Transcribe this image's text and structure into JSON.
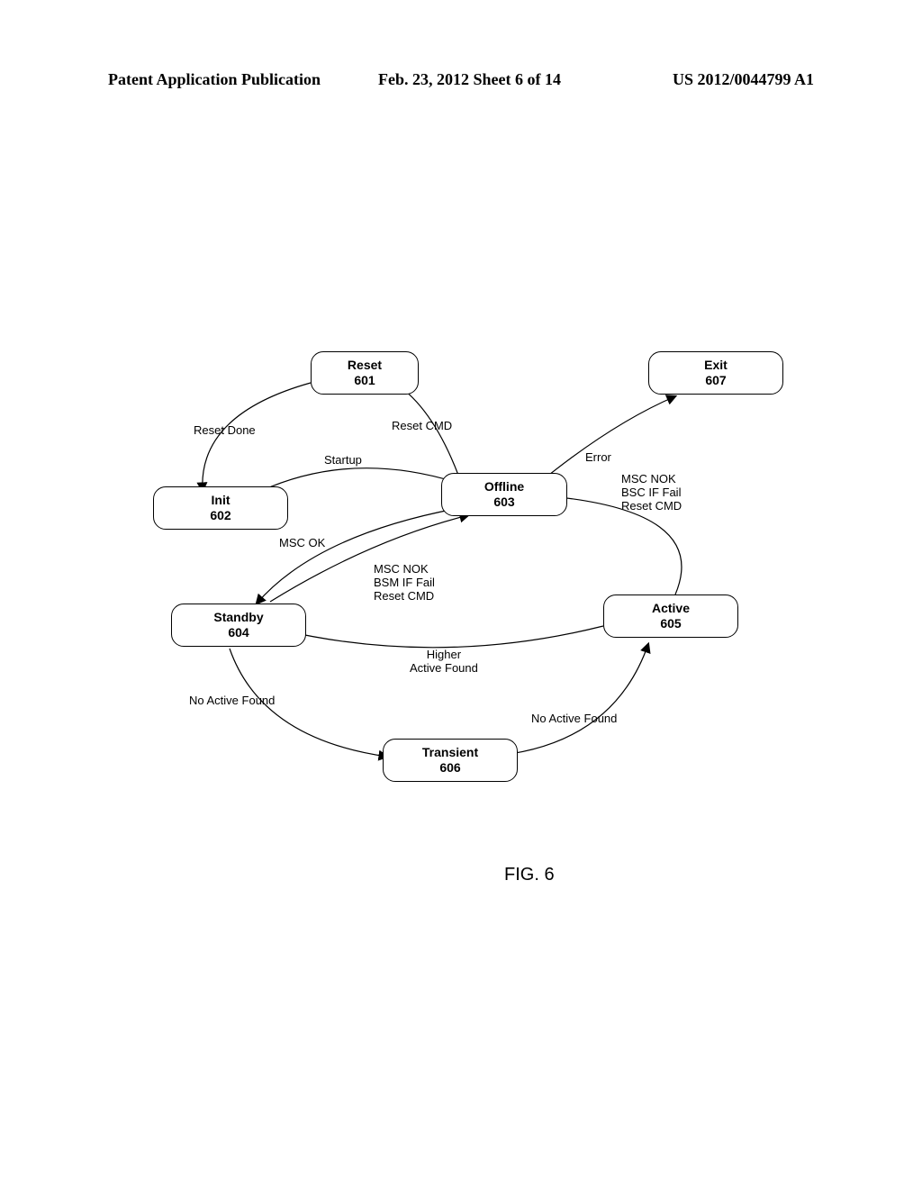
{
  "header": {
    "left": "Patent Application Publication",
    "center": "Feb. 23, 2012  Sheet 6 of 14",
    "right": "US 2012/0044799 A1"
  },
  "figure_caption": "FIG. 6",
  "nodes": {
    "reset": {
      "title": "Reset",
      "num": "601"
    },
    "init": {
      "title": "Init",
      "num": "602"
    },
    "offline": {
      "title": "Offline",
      "num": "603"
    },
    "standby": {
      "title": "Standby",
      "num": "604"
    },
    "active": {
      "title": "Active",
      "num": "605"
    },
    "transient": {
      "title": "Transient",
      "num": "606"
    },
    "exit": {
      "title": "Exit",
      "num": "607"
    }
  },
  "edges": {
    "reset_to_init": "Reset Done",
    "init_to_offline": "Startup",
    "offline_to_reset": "Reset CMD",
    "offline_to_standby": "MSC OK",
    "offline_to_exit": "Error",
    "standby_to_transient": "No Active Found",
    "transient_to_active": "No Active Found",
    "active_to_standby": "Higher\nActive Found",
    "active_to_offline": "MSC NOK\nBSC IF Fail\nReset CMD",
    "standby_to_offline": "MSC NOK\nBSM IF Fail\nReset CMD"
  }
}
